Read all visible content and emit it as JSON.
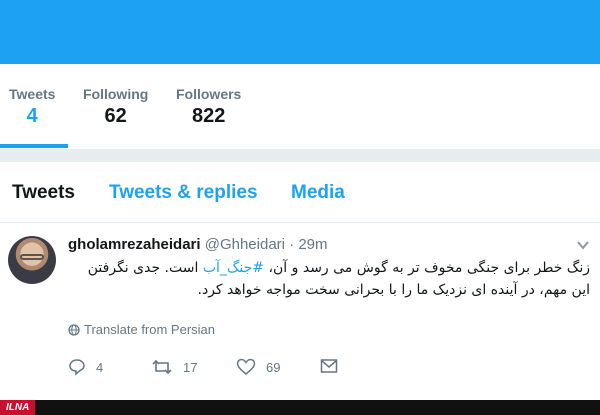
{
  "profile_stats": [
    {
      "label": "Tweets",
      "value": "4",
      "active": true
    },
    {
      "label": "Following",
      "value": "62"
    },
    {
      "label": "Followers",
      "value": "822"
    }
  ],
  "tabs": [
    {
      "label": "Tweets",
      "active": true
    },
    {
      "label": "Tweets & replies"
    },
    {
      "label": "Media"
    }
  ],
  "tweet": {
    "name": "gholamrezaheidari",
    "handle": "@Ghheidari",
    "separator": "·",
    "time": "29m",
    "text_before": "زنگ خطر برای جنگی مخوف تر به گوش می رسد و آن، ",
    "hashtag": "#جنگ_آب",
    "text_after": " است. جدی نگرفتن این مهم، در آینده ای نزدیک ما را با بحرانی سخت مواجه خواهد کرد.",
    "translate_label": "Translate from Persian",
    "actions": {
      "reply_count": "4",
      "retweet_count": "17",
      "like_count": "69"
    }
  },
  "footer": {
    "logo_text": "ILNA"
  },
  "colors": {
    "accent": "#1da1f2",
    "muted": "#657786",
    "text": "#14171a",
    "divider": "#e6ecf0"
  },
  "icons": [
    "chevron-down-icon",
    "globe-icon",
    "reply-icon",
    "retweet-icon",
    "heart-icon",
    "message-icon"
  ]
}
